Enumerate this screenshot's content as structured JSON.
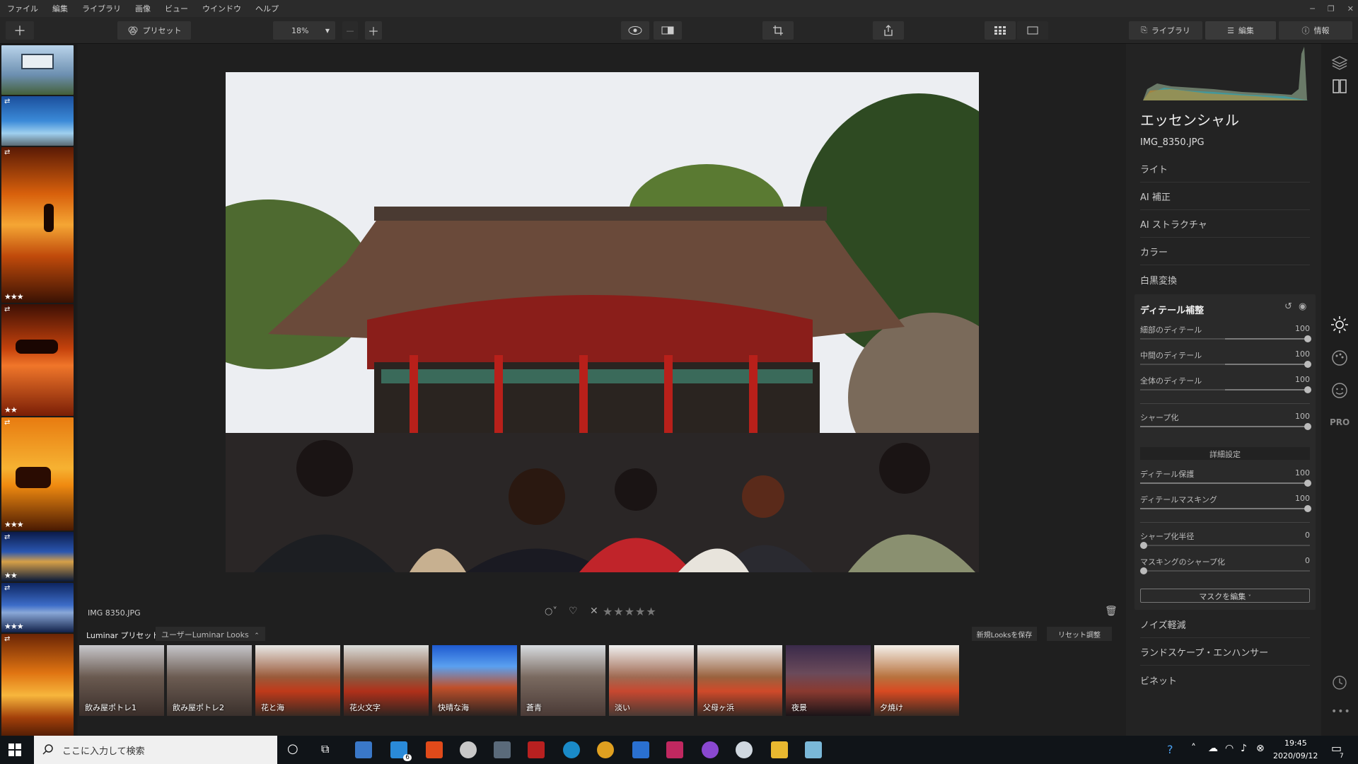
{
  "menu": {
    "items": [
      "ファイル",
      "編集",
      "ライブラリ",
      "画像",
      "ビュー",
      "ウインドウ",
      "ヘルプ"
    ]
  },
  "toolbar": {
    "preset_label": "プリセット",
    "zoom": "18%",
    "library_tab": "ライブラリ",
    "edit_tab": "編集",
    "info_tab": "情報"
  },
  "filmstrip": {
    "ratings": [
      "",
      "",
      "★★★",
      "★★",
      "★★★",
      "★★",
      "★★★",
      "★★★",
      ""
    ]
  },
  "panel": {
    "title": "エッセンシャル",
    "filename": "IMG_8350.JPG",
    "sections_top": [
      "ライト",
      "AI 補正",
      "AI ストラクチャ",
      "カラー",
      "白黒変換"
    ],
    "detail_title": "ディテール補整",
    "sliders1": [
      {
        "label": "細部のディテール",
        "value": "100"
      },
      {
        "label": "中間のディテール",
        "value": "100"
      },
      {
        "label": "全体のディテール",
        "value": "100"
      }
    ],
    "sharpen": {
      "label": "シャープ化",
      "value": "100"
    },
    "advanced_label": "詳細設定",
    "sliders2": [
      {
        "label": "ディテール保護",
        "value": "100"
      },
      {
        "label": "ディテールマスキング",
        "value": "100"
      }
    ],
    "sliders3": [
      {
        "label": "シャープ化半径",
        "value": "0"
      },
      {
        "label": "マスキングのシャープ化",
        "value": "0"
      }
    ],
    "mask_button": "マスクを編集",
    "sections_bottom": [
      "ノイズ軽減",
      "ランドスケープ・エンハンサー",
      "ビネット"
    ],
    "pro_label": "PRO"
  },
  "infobar": {
    "filename": "IMG 8350.JPG",
    "stars": "★★★★★"
  },
  "looksbar": {
    "tab1": "Luminar プリセット",
    "tab2": "ユーザーLuminar Looks",
    "save_btn": "新規Looksを保存",
    "reset_btn": "リセット調整"
  },
  "looks": [
    "飲み屋ポトレ1",
    "飲み屋ポトレ2",
    "花と海",
    "花火文字",
    "快晴な海",
    "蒼青",
    "淡い",
    "父母ヶ浜",
    "夜景",
    "夕焼け"
  ],
  "taskbar": {
    "search_placeholder": "ここに入力して検索",
    "time": "19:45",
    "date": "2020/09/12",
    "mail_badge": "6",
    "notify_badge": "7"
  }
}
